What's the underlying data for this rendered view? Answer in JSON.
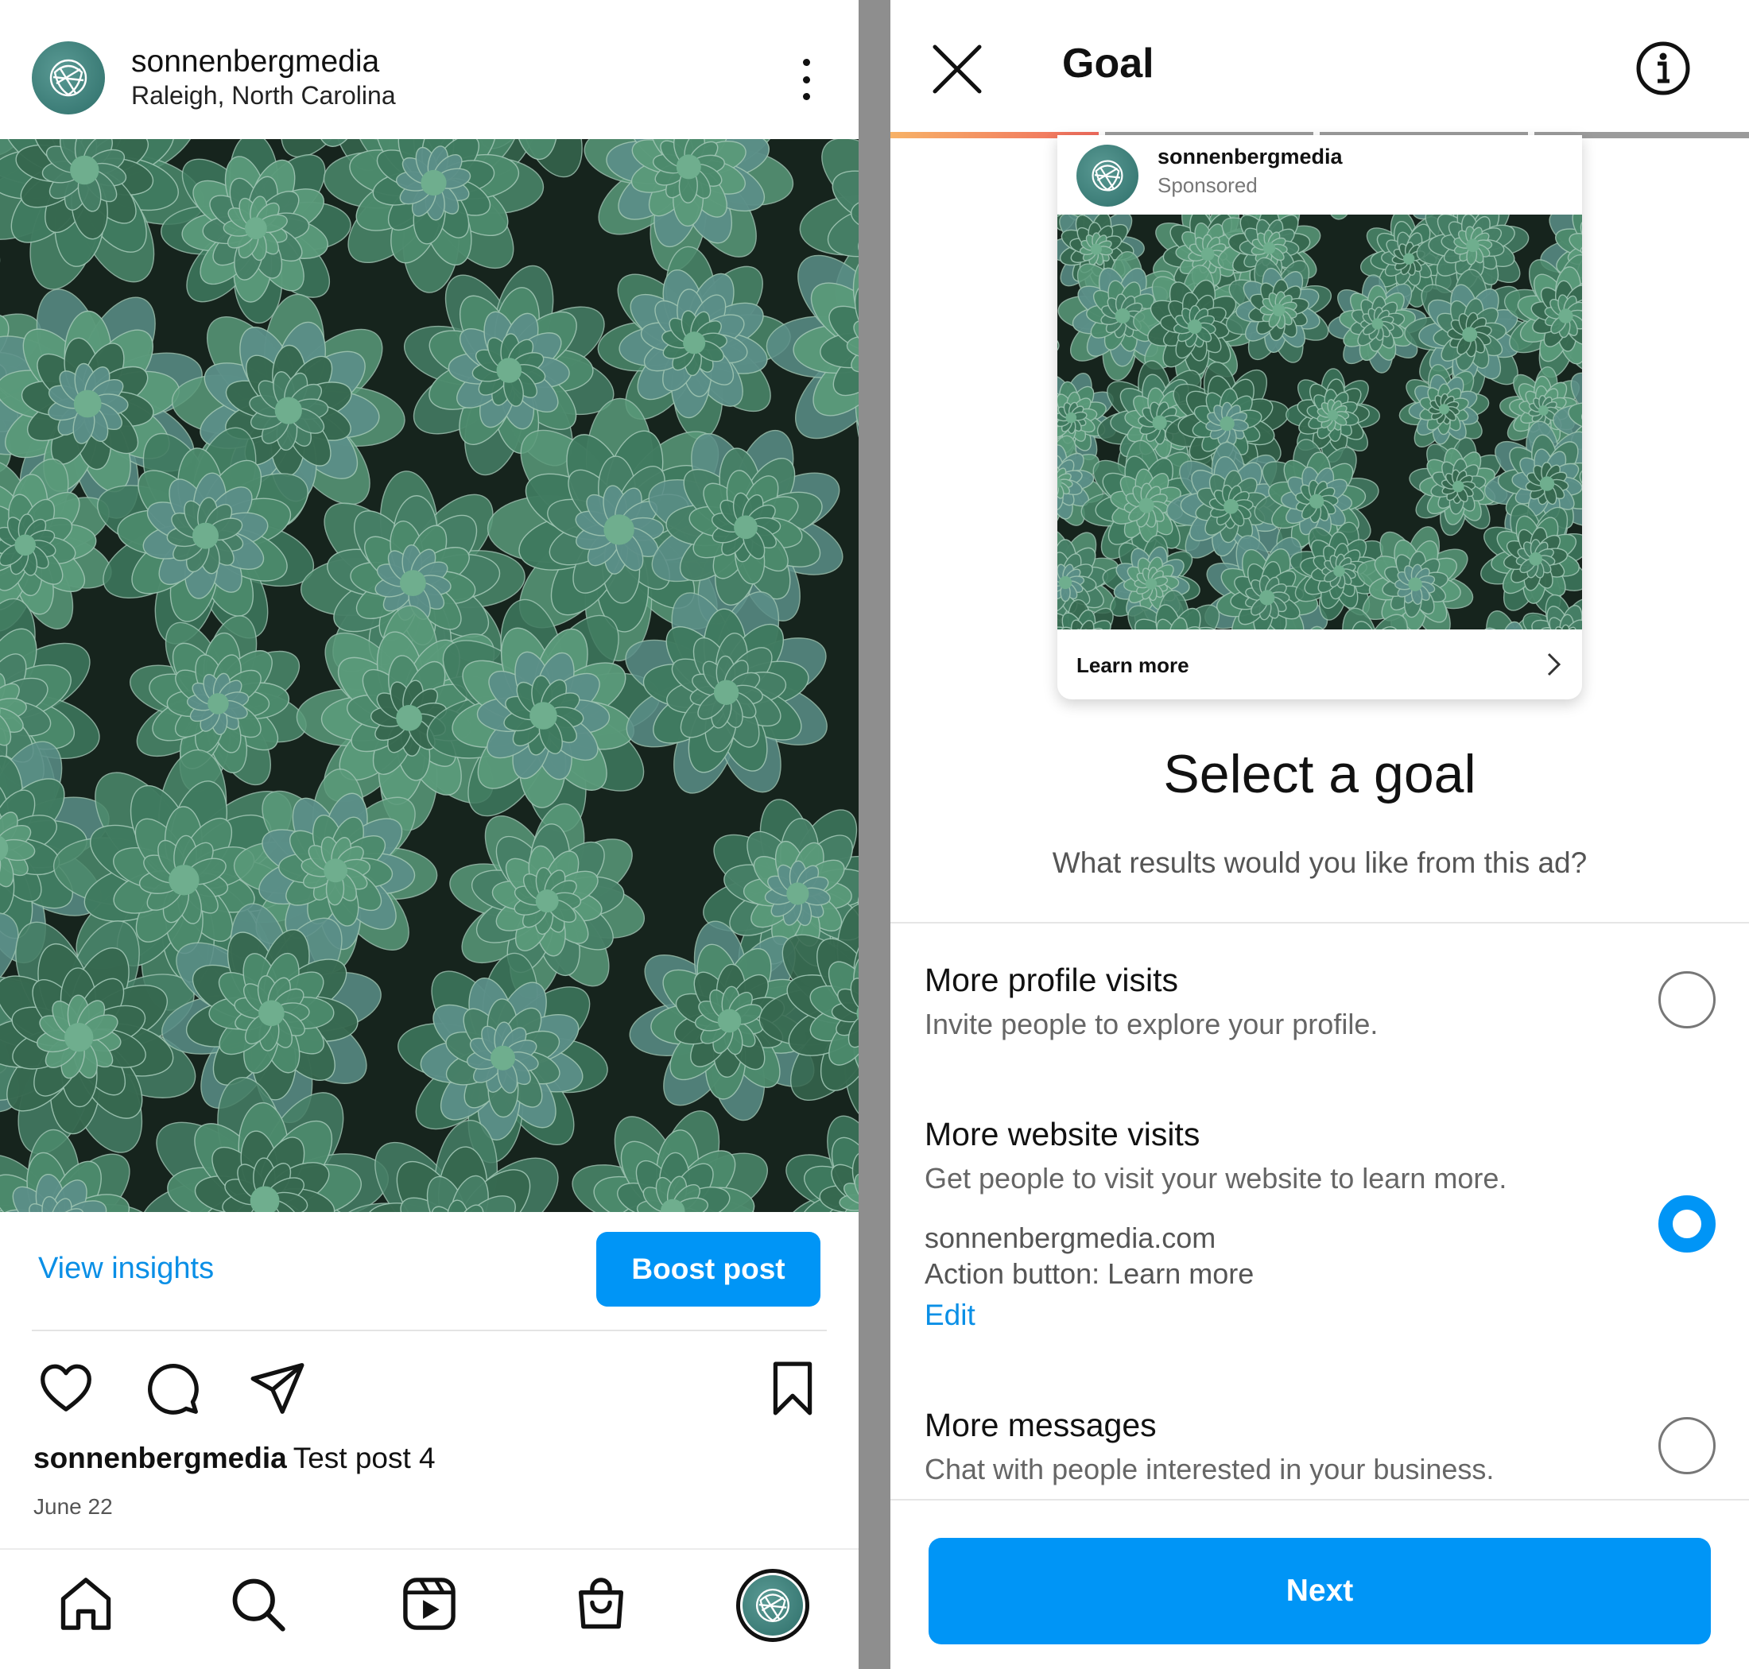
{
  "post": {
    "username": "sonnenbergmedia",
    "location": "Raleigh, North Carolina",
    "view_insights": "View insights",
    "boost_label": "Boost post",
    "caption_user": "sonnenbergmedia",
    "caption_text": "Test post 4",
    "date": "June 22",
    "photo_description_icon": "succulent-photo"
  },
  "nav": [
    "home-icon",
    "search-icon",
    "reels-icon",
    "shop-icon",
    "profile-avatar"
  ],
  "goal_screen": {
    "title": "Goal",
    "progress_segments": 4,
    "progress_current": 1,
    "preview": {
      "username": "sonnenbergmedia",
      "sponsored": "Sponsored",
      "cta": "Learn more"
    },
    "heading": "Select a goal",
    "subheading": "What results would you like from this ad?",
    "options": [
      {
        "title": "More profile visits",
        "description": "Invite people to explore your profile.",
        "selected": false
      },
      {
        "title": "More website visits",
        "description": "Get people to visit your website to learn more.",
        "website": "sonnenbergmedia.com",
        "action_button": "Action button: Learn more",
        "edit": "Edit",
        "selected": true
      },
      {
        "title": "More messages",
        "description": "Chat with people interested in your business.",
        "selected": false
      }
    ],
    "next_label": "Next"
  },
  "colors": {
    "accent_blue": "#0095f6",
    "link_blue": "#0a8fe6",
    "progress_active": "#f0955a",
    "progress_inactive": "#9b9b9b"
  }
}
